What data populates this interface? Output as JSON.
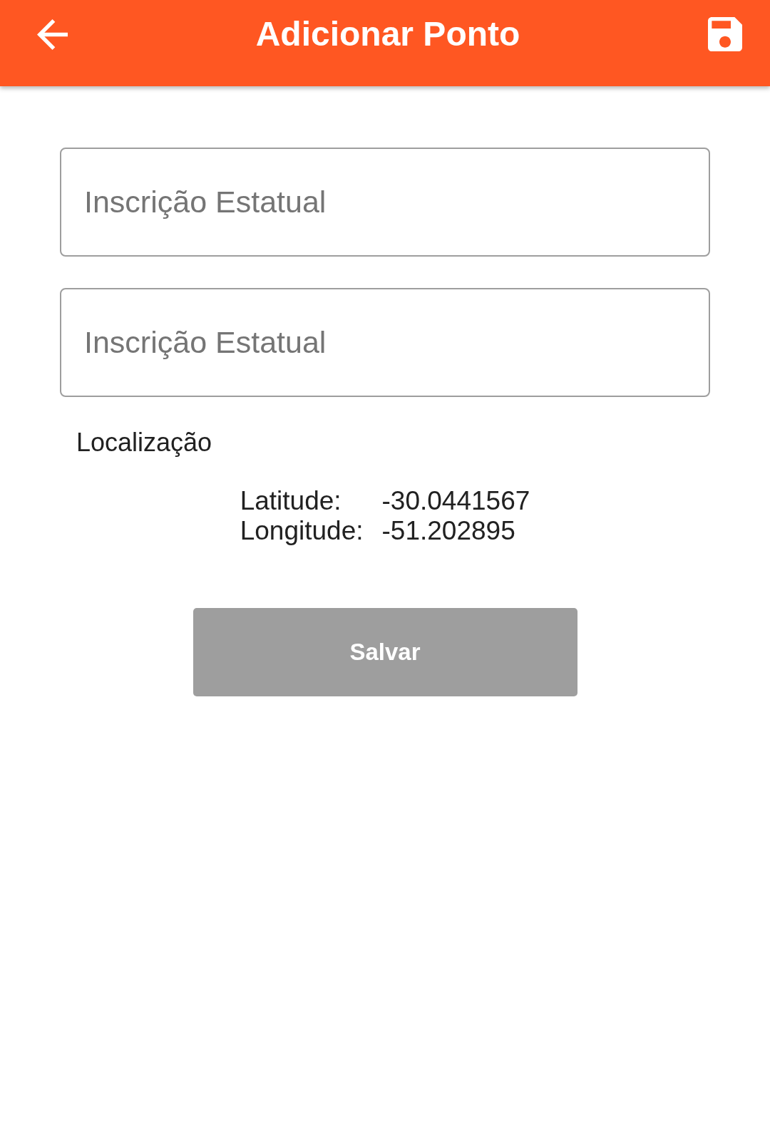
{
  "app_bar": {
    "title": "Adicionar Ponto"
  },
  "fields": [
    {
      "placeholder": "Inscrição Estatual"
    },
    {
      "placeholder": "Inscrição Estatual"
    }
  ],
  "location": {
    "label": "Localização",
    "rows": [
      {
        "label": "Latitude:",
        "value": "-30.0441567"
      },
      {
        "label": "Longitude:",
        "value": "-51.202895"
      }
    ]
  },
  "save_button": {
    "label": "Salvar",
    "disabled": true
  }
}
